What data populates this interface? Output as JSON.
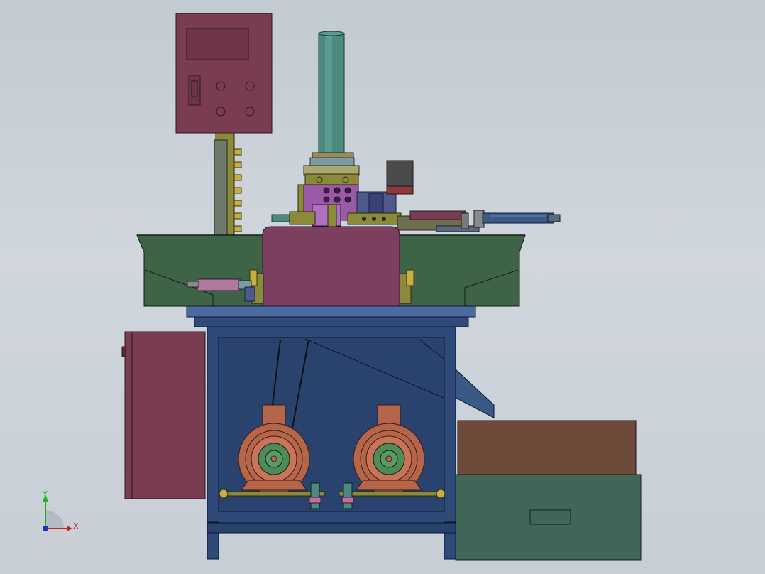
{
  "view": {
    "background_top": "#c2cad2",
    "background_bottom": "#c7ced6"
  },
  "triad": {
    "x_label": "X",
    "y_label": "Y",
    "x_color": "#cc2020",
    "y_color": "#20b020",
    "z_color": "#2030c0"
  },
  "colors": {
    "control_box": "#7a3c50",
    "frame_blue": "#2f4a78",
    "table_green": "#3f6347",
    "pink_panel": "#7d3f5f",
    "motor_copper": "#b5654a",
    "pulley_green": "#4f8a5a",
    "cylinder_teal": "#4b8a80",
    "bin_brown": "#6e4a3a",
    "bin_green": "#3f6656",
    "post_olive": "#8a8a3a",
    "actuator_blue": "#3b5a88",
    "magenta_block": "#9a5aa8"
  }
}
